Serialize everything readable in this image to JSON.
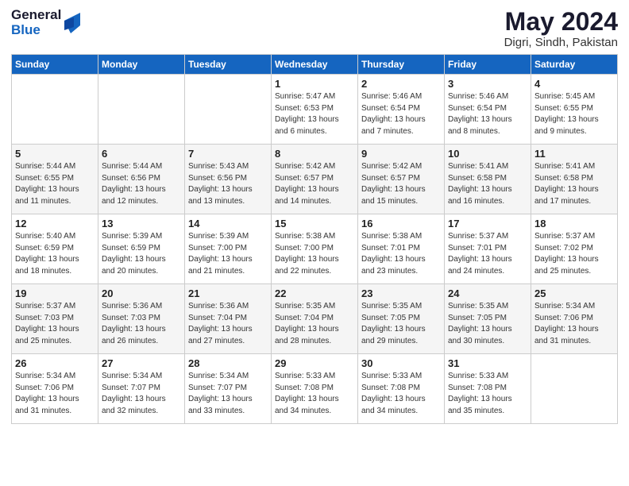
{
  "logo": {
    "line1": "General",
    "line2": "Blue"
  },
  "title": "May 2024",
  "subtitle": "Digri, Sindh, Pakistan",
  "headers": [
    "Sunday",
    "Monday",
    "Tuesday",
    "Wednesday",
    "Thursday",
    "Friday",
    "Saturday"
  ],
  "weeks": [
    [
      {
        "day": "",
        "info": ""
      },
      {
        "day": "",
        "info": ""
      },
      {
        "day": "",
        "info": ""
      },
      {
        "day": "1",
        "info": "Sunrise: 5:47 AM\nSunset: 6:53 PM\nDaylight: 13 hours\nand 6 minutes."
      },
      {
        "day": "2",
        "info": "Sunrise: 5:46 AM\nSunset: 6:54 PM\nDaylight: 13 hours\nand 7 minutes."
      },
      {
        "day": "3",
        "info": "Sunrise: 5:46 AM\nSunset: 6:54 PM\nDaylight: 13 hours\nand 8 minutes."
      },
      {
        "day": "4",
        "info": "Sunrise: 5:45 AM\nSunset: 6:55 PM\nDaylight: 13 hours\nand 9 minutes."
      }
    ],
    [
      {
        "day": "5",
        "info": "Sunrise: 5:44 AM\nSunset: 6:55 PM\nDaylight: 13 hours\nand 11 minutes."
      },
      {
        "day": "6",
        "info": "Sunrise: 5:44 AM\nSunset: 6:56 PM\nDaylight: 13 hours\nand 12 minutes."
      },
      {
        "day": "7",
        "info": "Sunrise: 5:43 AM\nSunset: 6:56 PM\nDaylight: 13 hours\nand 13 minutes."
      },
      {
        "day": "8",
        "info": "Sunrise: 5:42 AM\nSunset: 6:57 PM\nDaylight: 13 hours\nand 14 minutes."
      },
      {
        "day": "9",
        "info": "Sunrise: 5:42 AM\nSunset: 6:57 PM\nDaylight: 13 hours\nand 15 minutes."
      },
      {
        "day": "10",
        "info": "Sunrise: 5:41 AM\nSunset: 6:58 PM\nDaylight: 13 hours\nand 16 minutes."
      },
      {
        "day": "11",
        "info": "Sunrise: 5:41 AM\nSunset: 6:58 PM\nDaylight: 13 hours\nand 17 minutes."
      }
    ],
    [
      {
        "day": "12",
        "info": "Sunrise: 5:40 AM\nSunset: 6:59 PM\nDaylight: 13 hours\nand 18 minutes."
      },
      {
        "day": "13",
        "info": "Sunrise: 5:39 AM\nSunset: 6:59 PM\nDaylight: 13 hours\nand 20 minutes."
      },
      {
        "day": "14",
        "info": "Sunrise: 5:39 AM\nSunset: 7:00 PM\nDaylight: 13 hours\nand 21 minutes."
      },
      {
        "day": "15",
        "info": "Sunrise: 5:38 AM\nSunset: 7:00 PM\nDaylight: 13 hours\nand 22 minutes."
      },
      {
        "day": "16",
        "info": "Sunrise: 5:38 AM\nSunset: 7:01 PM\nDaylight: 13 hours\nand 23 minutes."
      },
      {
        "day": "17",
        "info": "Sunrise: 5:37 AM\nSunset: 7:01 PM\nDaylight: 13 hours\nand 24 minutes."
      },
      {
        "day": "18",
        "info": "Sunrise: 5:37 AM\nSunset: 7:02 PM\nDaylight: 13 hours\nand 25 minutes."
      }
    ],
    [
      {
        "day": "19",
        "info": "Sunrise: 5:37 AM\nSunset: 7:03 PM\nDaylight: 13 hours\nand 25 minutes."
      },
      {
        "day": "20",
        "info": "Sunrise: 5:36 AM\nSunset: 7:03 PM\nDaylight: 13 hours\nand 26 minutes."
      },
      {
        "day": "21",
        "info": "Sunrise: 5:36 AM\nSunset: 7:04 PM\nDaylight: 13 hours\nand 27 minutes."
      },
      {
        "day": "22",
        "info": "Sunrise: 5:35 AM\nSunset: 7:04 PM\nDaylight: 13 hours\nand 28 minutes."
      },
      {
        "day": "23",
        "info": "Sunrise: 5:35 AM\nSunset: 7:05 PM\nDaylight: 13 hours\nand 29 minutes."
      },
      {
        "day": "24",
        "info": "Sunrise: 5:35 AM\nSunset: 7:05 PM\nDaylight: 13 hours\nand 30 minutes."
      },
      {
        "day": "25",
        "info": "Sunrise: 5:34 AM\nSunset: 7:06 PM\nDaylight: 13 hours\nand 31 minutes."
      }
    ],
    [
      {
        "day": "26",
        "info": "Sunrise: 5:34 AM\nSunset: 7:06 PM\nDaylight: 13 hours\nand 31 minutes."
      },
      {
        "day": "27",
        "info": "Sunrise: 5:34 AM\nSunset: 7:07 PM\nDaylight: 13 hours\nand 32 minutes."
      },
      {
        "day": "28",
        "info": "Sunrise: 5:34 AM\nSunset: 7:07 PM\nDaylight: 13 hours\nand 33 minutes."
      },
      {
        "day": "29",
        "info": "Sunrise: 5:33 AM\nSunset: 7:08 PM\nDaylight: 13 hours\nand 34 minutes."
      },
      {
        "day": "30",
        "info": "Sunrise: 5:33 AM\nSunset: 7:08 PM\nDaylight: 13 hours\nand 34 minutes."
      },
      {
        "day": "31",
        "info": "Sunrise: 5:33 AM\nSunset: 7:08 PM\nDaylight: 13 hours\nand 35 minutes."
      },
      {
        "day": "",
        "info": ""
      }
    ]
  ]
}
